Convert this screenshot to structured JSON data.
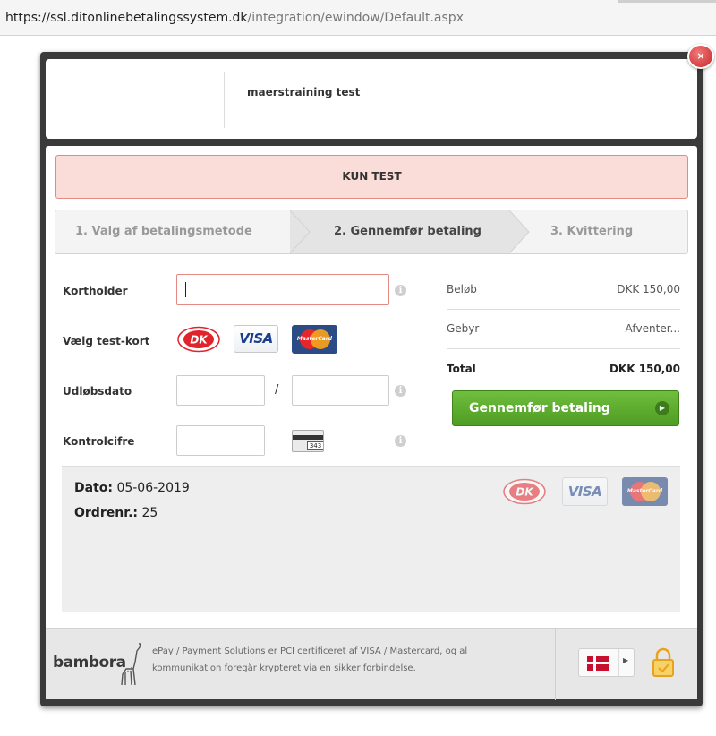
{
  "browser": {
    "url_host": "https://ssl.ditonlinebetalingssystem.dk",
    "url_path": "/integration/ewindow/Default.aspx"
  },
  "modal": {
    "close_label": "×",
    "merchant_name": "maerstraining test",
    "test_banner": "KUN TEST"
  },
  "steps": [
    {
      "label": "1. Valg af betalingsmetode",
      "state": "done"
    },
    {
      "label": "2. Gennemfør betaling",
      "state": "active"
    },
    {
      "label": "3. Kvittering",
      "state": "pending"
    }
  ],
  "form": {
    "cardholder_label": "Kortholder",
    "cardholder_value": "",
    "test_card_label": "Vælg test-kort",
    "expiry_label": "Udløbsdato",
    "expiry_separator": "/",
    "cvc_label": "Kontrolcifre",
    "cvc_sample": "343",
    "info_symbol": "i"
  },
  "cards": {
    "dankort": "DK",
    "visa": "VISA",
    "mastercard": "MasterCard"
  },
  "summary": {
    "amount_label": "Beløb",
    "amount_value": "DKK 150,00",
    "fee_label": "Gebyr",
    "fee_value": "Afventer...",
    "total_label": "Total",
    "total_value": "DKK 150,00",
    "pay_button": "Gennemfør betaling"
  },
  "order": {
    "date_label": "Dato:",
    "date_value": "05-06-2019",
    "order_label": "Ordrenr.:",
    "order_value": "25"
  },
  "footer": {
    "brand": "bambora",
    "text": "ePay / Payment Solutions er PCI certificeret af VISA / Mastercard, og al kommunikation foregår krypteret via en sikker forbindelse.",
    "language": "Dansk"
  },
  "colors": {
    "accent_green": "#5aa92c",
    "test_banner_bg": "#fadcd8",
    "dankort_red": "#e0242b",
    "visa_blue": "#1a3e8c"
  },
  "icons": {
    "close": "close-icon",
    "info": "info-icon",
    "arrow": "arrow-right-icon",
    "lock": "lock-icon",
    "flag": "danish-flag-icon"
  }
}
